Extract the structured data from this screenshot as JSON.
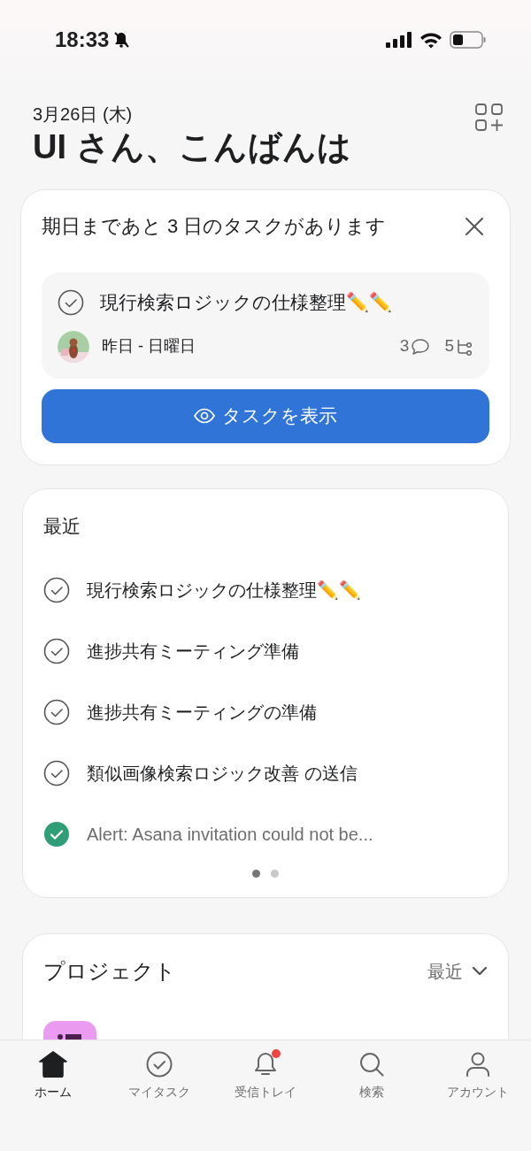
{
  "status_bar": {
    "time": "18:33",
    "silent": true
  },
  "header": {
    "date": "3月26日 (木)",
    "greeting": "UI さん、こんばんは"
  },
  "due_card": {
    "title": "期日まであと 3 日のタスクがあります",
    "task": {
      "name": "現行検索ロジックの仕様整理✏️✏️",
      "checked": false,
      "due": "昨日 - 日曜日",
      "comments": "3",
      "subtasks": "5"
    },
    "button": "タスクを表示"
  },
  "recent": {
    "title": "最近",
    "items": [
      {
        "name": "現行検索ロジックの仕様整理✏️✏️",
        "checked": false
      },
      {
        "name": "進捗共有ミーティング準備",
        "checked": false
      },
      {
        "name": "進捗共有ミーティングの準備",
        "checked": false
      },
      {
        "name": "類似画像検索ロジック改善 の送信",
        "checked": false
      },
      {
        "name": "Alert: Asana invitation could not be...",
        "checked": true
      }
    ],
    "pages": [
      {
        "selected": true
      },
      {
        "selected": false
      }
    ]
  },
  "projects": {
    "title": "プロジェクト",
    "sort": "最近",
    "items": [
      {
        "color": "#ec9cf0"
      }
    ]
  },
  "tab_bar": [
    {
      "label": "ホーム",
      "kind": "home",
      "selected": true,
      "badge": false
    },
    {
      "label": "マイタスク",
      "kind": "tasks",
      "selected": false,
      "badge": false
    },
    {
      "label": "受信トレイ",
      "kind": "inbox",
      "selected": false,
      "badge": true
    },
    {
      "label": "検索",
      "kind": "search",
      "selected": false,
      "badge": false
    },
    {
      "label": "アカウント",
      "kind": "account",
      "selected": false,
      "badge": false
    }
  ]
}
